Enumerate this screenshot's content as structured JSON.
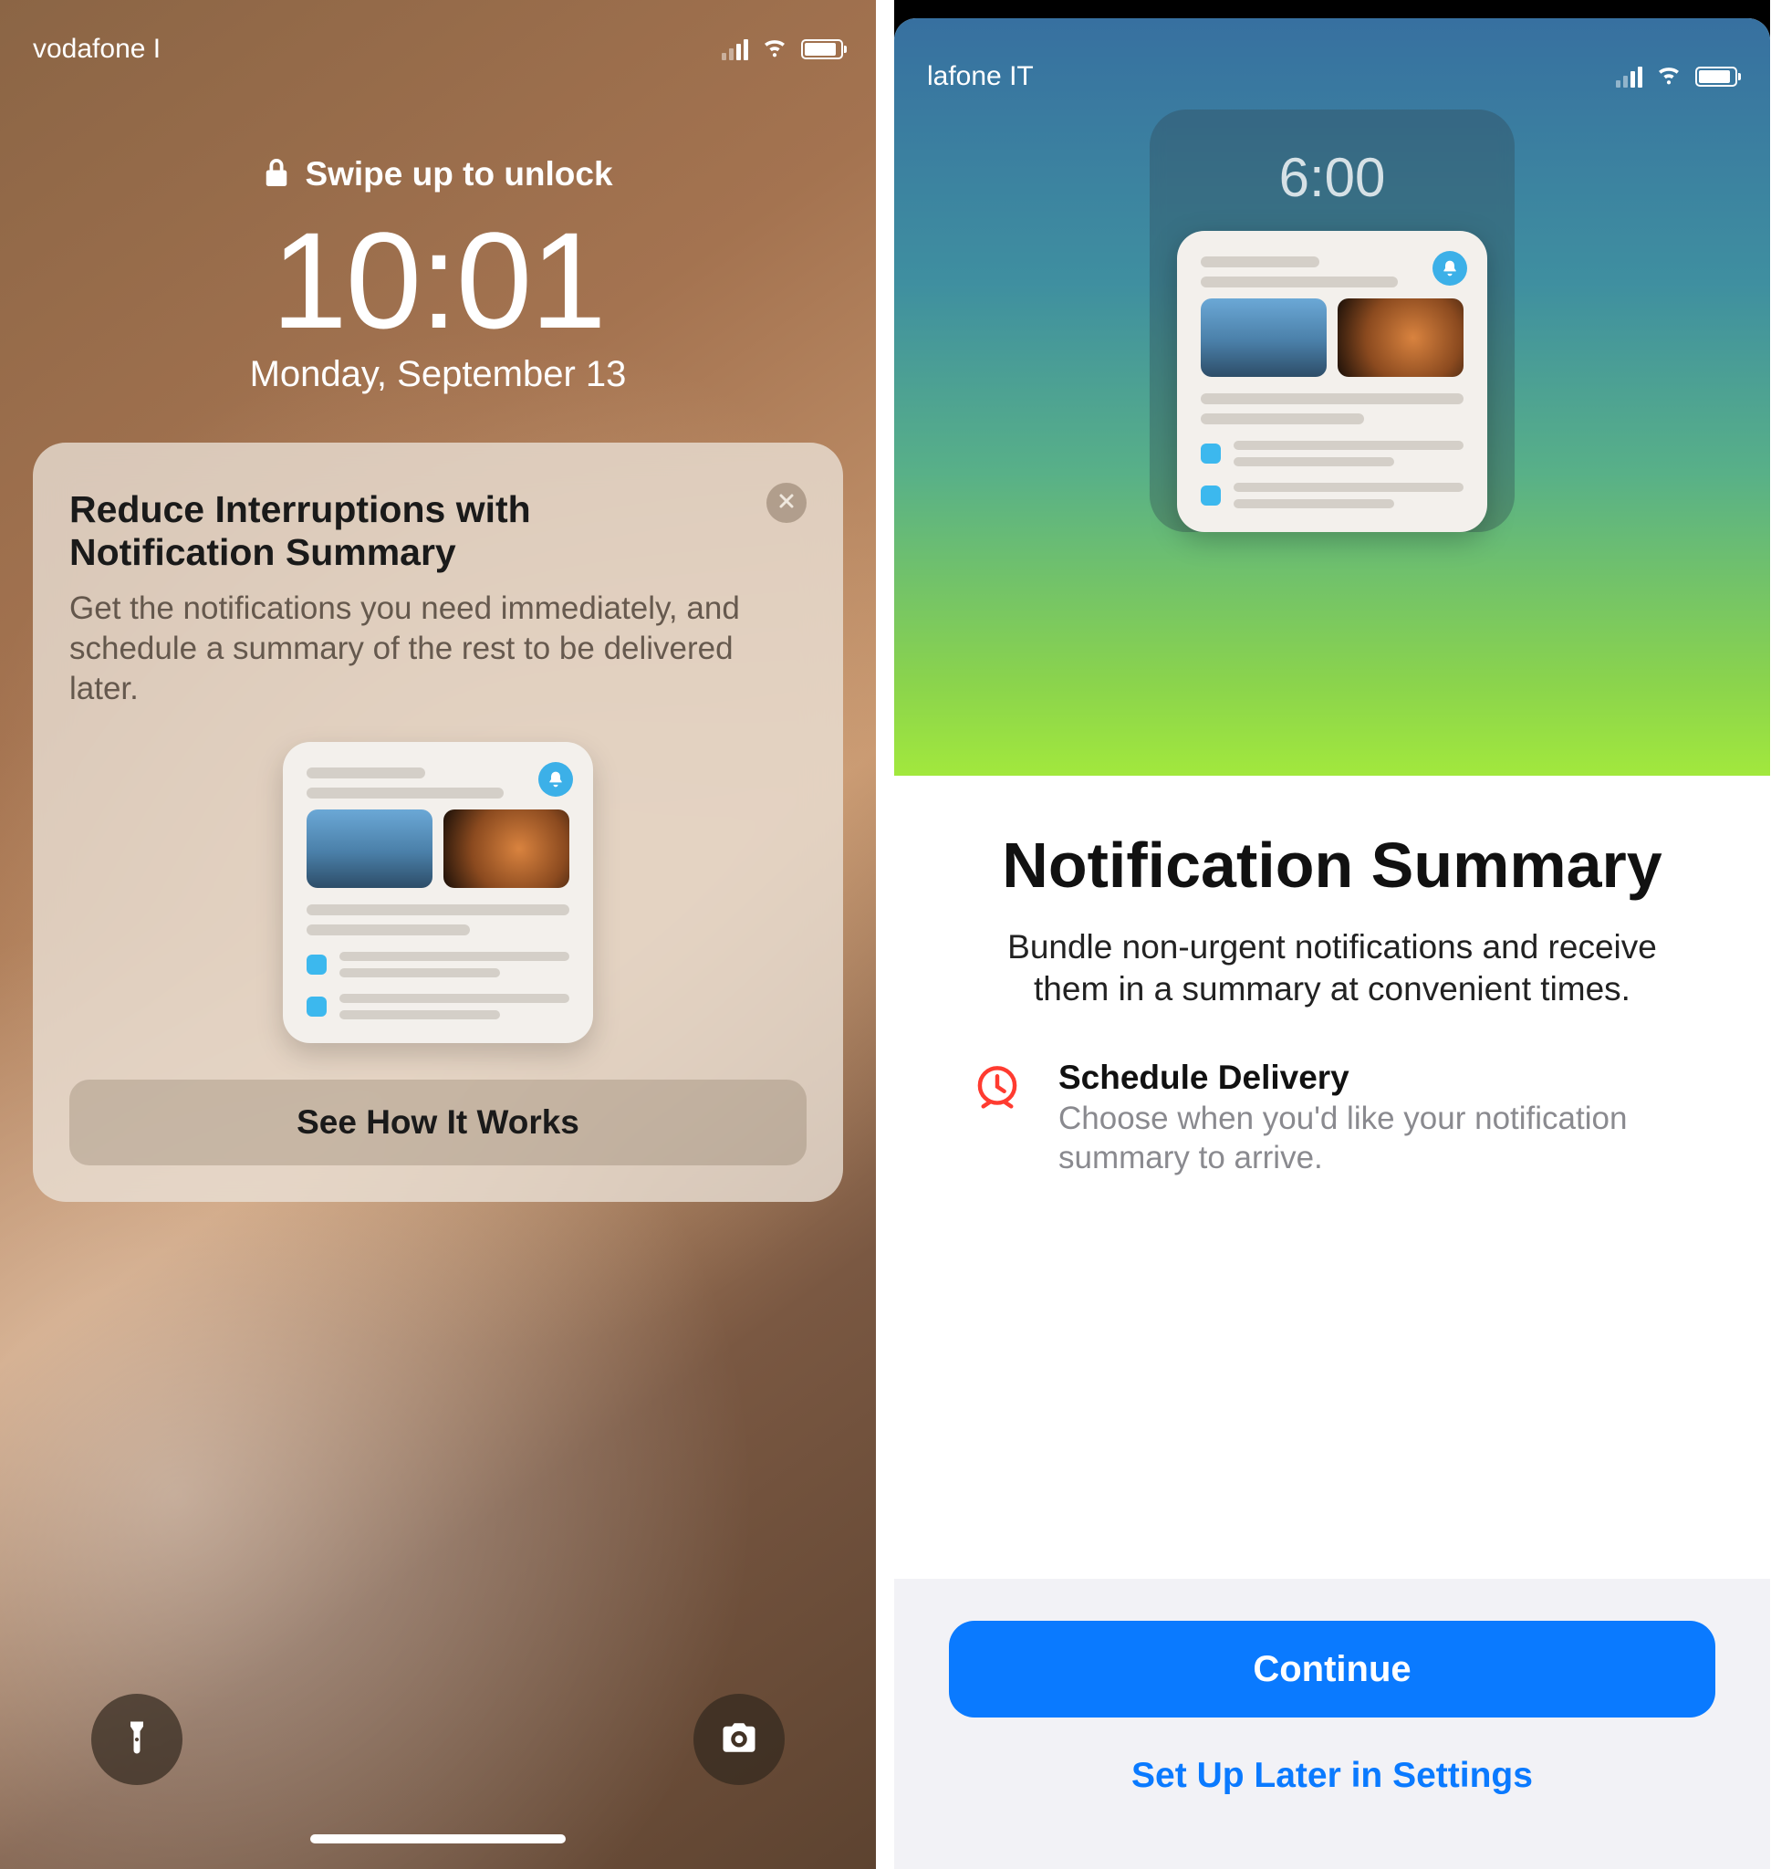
{
  "left": {
    "carrier": "vodafone I",
    "unlock_text": "Swipe up to unlock",
    "clock_time": "10:01",
    "clock_date": "Monday, September 13",
    "card": {
      "title": "Reduce Interruptions with Notification Summary",
      "body": "Get the notifications you need immediately, and schedule a summary of the rest to be delivered later.",
      "cta": "See How It Works"
    }
  },
  "right": {
    "carrier": "lafone IT",
    "mini_time": "6:00",
    "title": "Notification Summary",
    "desc": "Bundle non-urgent notifications and receive them in a summary at convenient times.",
    "feature": {
      "name": "Schedule Delivery",
      "sub": "Choose when you'd like your notification summary to arrive."
    },
    "primary_btn": "Continue",
    "secondary": "Set Up Later in Settings"
  }
}
